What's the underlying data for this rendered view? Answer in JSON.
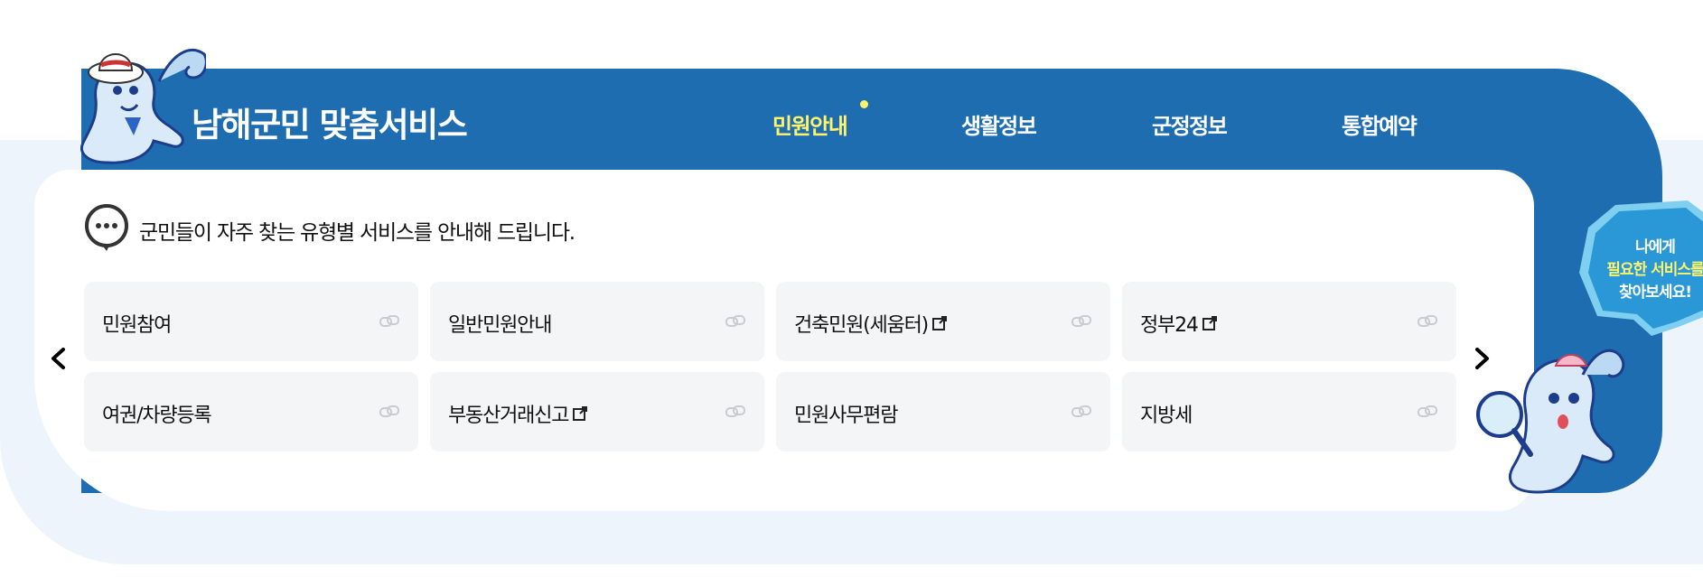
{
  "header": {
    "title": "남해군민 맞춤서비스",
    "tabs": [
      {
        "label": "민원안내",
        "active": true
      },
      {
        "label": "생활정보",
        "active": false
      },
      {
        "label": "군정정보",
        "active": false
      },
      {
        "label": "통합예약",
        "active": false
      }
    ]
  },
  "intro": {
    "text": "군민들이 자주 찾는 유형별 서비스를 안내해 드립니다.",
    "icon": "chat-bubble-icon"
  },
  "services": [
    {
      "label": "민원참여",
      "external": false
    },
    {
      "label": "일반민원안내",
      "external": false
    },
    {
      "label": "건축민원(세움터)",
      "external": true
    },
    {
      "label": "정부24",
      "external": true
    },
    {
      "label": "여권/차량등록",
      "external": false
    },
    {
      "label": "부동산거래신고",
      "external": true
    },
    {
      "label": "민원사무편람",
      "external": false
    },
    {
      "label": "지방세",
      "external": false
    }
  ],
  "carousel": {
    "prev_icon": "chevron-left-icon",
    "next_icon": "chevron-right-icon"
  },
  "bubble": {
    "line1": "나에게",
    "line2": "필요한 서비스를",
    "line3": "찾아보세요!"
  },
  "colors": {
    "primary_blue": "#1e6db1",
    "active_tab": "#fff36b",
    "tile_bg": "#f4f5f7",
    "bubble": "#3aa6e0"
  }
}
